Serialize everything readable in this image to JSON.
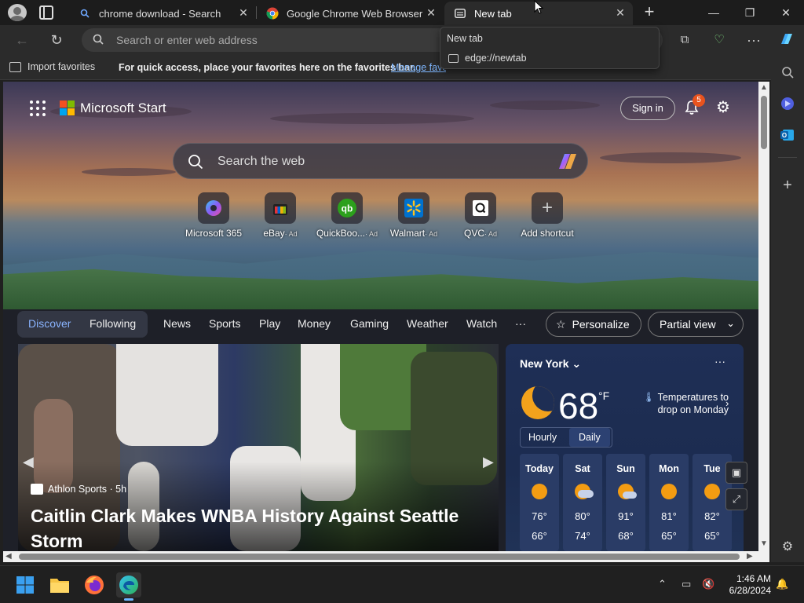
{
  "tabs": [
    {
      "title": "chrome download - Search",
      "favicon": "search-favicon"
    },
    {
      "title": "Google Chrome Web Browser",
      "favicon": "chrome-favicon"
    },
    {
      "title": "New tab",
      "favicon": "newtab-favicon",
      "active": true
    }
  ],
  "toolbar": {
    "address_placeholder": "Search or enter web address"
  },
  "favorites_bar": {
    "import_label": "Import favorites",
    "message": "For quick access, place your favorites here on the favorites bar.",
    "manage_link": "Manage favorites"
  },
  "tooltip": {
    "title": "New tab",
    "url": "edge://newtab"
  },
  "ms_start": {
    "brand": "Microsoft Start",
    "sign_in": "Sign in",
    "notification_count": "5",
    "search_placeholder": "Search the web"
  },
  "shortcuts": [
    {
      "label": "Microsoft 365",
      "ad": ""
    },
    {
      "label": "eBay",
      "ad": "· Ad"
    },
    {
      "label": "QuickBoo...",
      "ad": "· Ad"
    },
    {
      "label": "Walmart",
      "ad": "· Ad"
    },
    {
      "label": "QVC",
      "ad": "· Ad"
    },
    {
      "label": "Add shortcut",
      "ad": ""
    }
  ],
  "nav": {
    "discover": "Discover",
    "following": "Following",
    "links": [
      "News",
      "Sports",
      "Play",
      "Money",
      "Gaming",
      "Weather",
      "Watch",
      "···"
    ],
    "personalize": "Personalize",
    "partial_view": "Partial view"
  },
  "news": {
    "source": "Athlon Sports · 5h",
    "headline": "Caitlin Clark Makes WNBA History Against Seattle Storm"
  },
  "weather": {
    "city": "New York",
    "temp": "68",
    "unit": "°F",
    "alert": "Temperatures to drop on Monday",
    "toggle": [
      "Hourly",
      "Daily"
    ],
    "days": [
      {
        "name": "Today",
        "hi": "76°",
        "lo": "66°",
        "icon": "sun-icon"
      },
      {
        "name": "Sat",
        "hi": "80°",
        "lo": "74°",
        "icon": "partly-cloudy-icon"
      },
      {
        "name": "Sun",
        "hi": "91°",
        "lo": "68°",
        "icon": "partly-cloudy-icon"
      },
      {
        "name": "Mon",
        "hi": "81°",
        "lo": "65°",
        "icon": "sun-icon"
      },
      {
        "name": "Tue",
        "hi": "82°",
        "lo": "65°",
        "icon": "sun-icon"
      }
    ]
  },
  "taskbar": {
    "time": "1:46 AM",
    "date": "6/28/2024"
  },
  "colors": {
    "accent_link": "#7fb7ff",
    "badge": "#e8531e",
    "weather_bg": "#1f2f56"
  }
}
